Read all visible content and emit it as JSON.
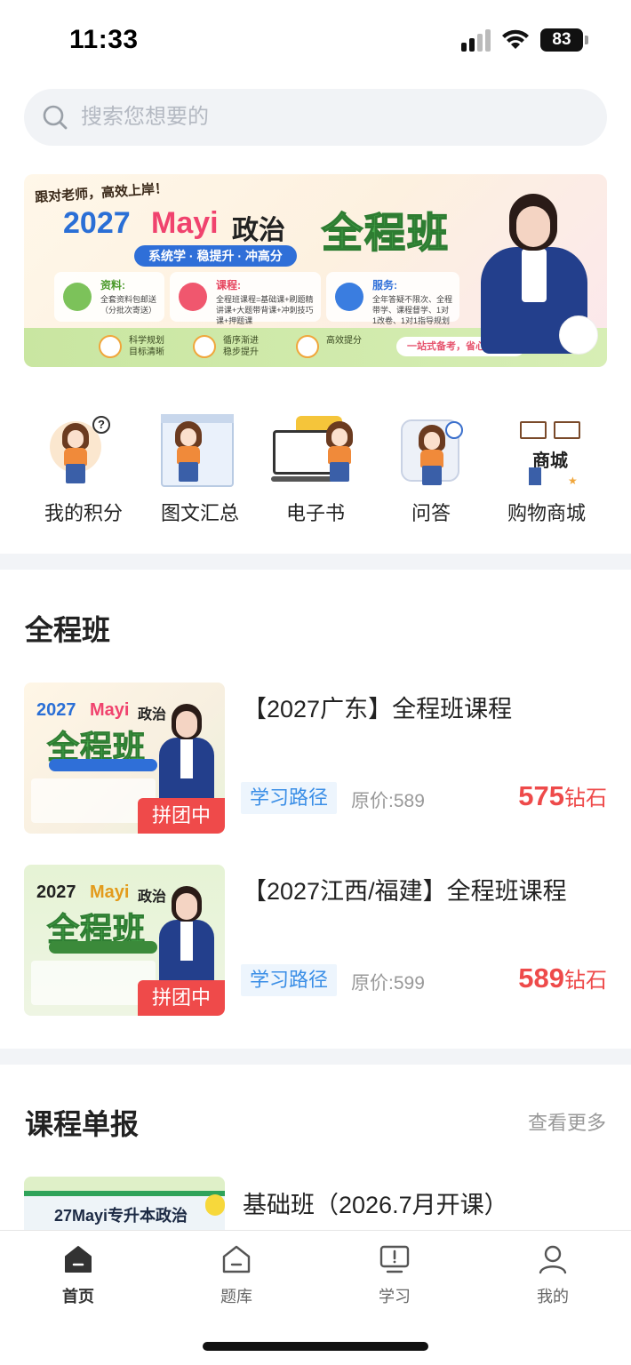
{
  "status_bar": {
    "time": "11:33",
    "battery": "83"
  },
  "search": {
    "placeholder": "搜索您想要的"
  },
  "banner": {
    "tagline": "跟对老师，高效上岸！",
    "year": "2027",
    "brand": "Mayi",
    "subject": "政治",
    "main_title": "全程班",
    "slogan": "系统学 · 稳提升 · 冲高分",
    "info": [
      {
        "title": "资料:",
        "text": "全套资料包邮送（分批次寄送）"
      },
      {
        "title": "课程:",
        "text": "全程班课程=基础课+刷题精讲课+大题带背课+冲刺技巧课+押题课"
      },
      {
        "title": "服务:",
        "text": "全年答疑不限次、全程带学、课程督学、1对1改卷、1对1指导规划"
      }
    ],
    "features": [
      {
        "title": "科学规划",
        "sub": "目标清晰"
      },
      {
        "title": "循序渐进",
        "sub": "稳步提升"
      },
      {
        "title": "高效提分",
        "sub": ""
      }
    ],
    "pill": "一站式备考，省心更高效"
  },
  "quick_nav": [
    {
      "label": "我的积分",
      "icon": "points-icon"
    },
    {
      "label": "图文汇总",
      "icon": "calendar-icon"
    },
    {
      "label": "电子书",
      "icon": "ebook-icon"
    },
    {
      "label": "问答",
      "icon": "qa-icon"
    },
    {
      "label": "购物商城",
      "icon": "shop-icon",
      "sign": "商城"
    }
  ],
  "full_course": {
    "title": "全程班",
    "courses": [
      {
        "title": "【2027广东】全程班课程",
        "tag": "学习路径",
        "original_price": "原价:589",
        "price": "575",
        "unit": "钻石",
        "badge": "拼团中",
        "thumb": {
          "year": "2027",
          "brand": "Mayi",
          "subject": "政治",
          "main": "全程班"
        }
      },
      {
        "title": "【2027江西/福建】全程班课程",
        "tag": "学习路径",
        "original_price": "原价:599",
        "price": "589",
        "unit": "钻石",
        "badge": "拼团中",
        "thumb": {
          "year": "2027",
          "brand": "Mayi",
          "subject": "政治",
          "main": "全程班"
        }
      }
    ]
  },
  "course_report": {
    "title": "课程单报",
    "more": "查看更多",
    "first": {
      "title": "基础班（2026.7月开课）",
      "thumb_text": "27Mayi专升本政治"
    }
  },
  "tab_bar": [
    {
      "label": "首页",
      "icon": "home-icon",
      "active": true
    },
    {
      "label": "题库",
      "icon": "question-bank-icon",
      "active": false
    },
    {
      "label": "学习",
      "icon": "study-icon",
      "active": false
    },
    {
      "label": "我的",
      "icon": "profile-icon",
      "active": false
    }
  ],
  "colors": {
    "accent": "#3a8ee6",
    "price": "#ee4a4a",
    "badge": "#ef4a4a",
    "green": "#4caf50"
  }
}
